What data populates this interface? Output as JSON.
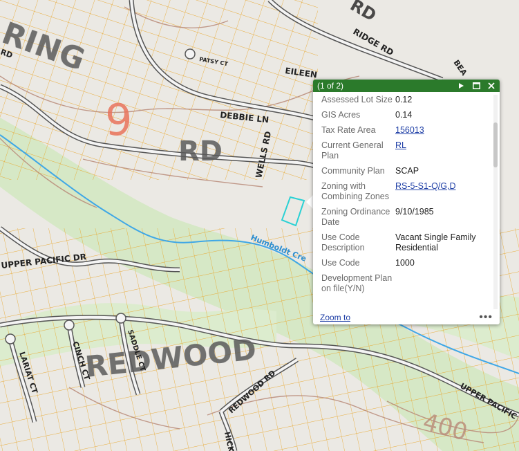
{
  "map": {
    "neighborhood_labels": [
      "RING",
      "RD",
      "REDWOOD"
    ],
    "district_number": "9",
    "elevation_label": "400",
    "streets": {
      "ridge": "RIDGE RD",
      "patsy": "PATSY CT",
      "eileen": "EILEEN",
      "debbie": "DEBBIE LN",
      "wells": "WELLS RD",
      "upper_pacific": "UPPER PACIFIC DR",
      "upper_pacific_2": "UPPER PACIFIC",
      "lariat": "LARIAT CT",
      "cinch": "CINCH CT",
      "saddle": "SADDLE CT",
      "redwood_rd": "REDWOOD RD",
      "hick": "HICK",
      "bea": "BEA",
      "rd_top": "RD",
      "rd_left": "RD"
    },
    "creek_label": "Humboldt Cre",
    "colors": {
      "parcel": "#e8a528",
      "creek": "#3fa7e6",
      "green": "#cfe5bf",
      "contour": "#b98a78",
      "district": "#e9745c",
      "highlight": "#2ad1d4"
    }
  },
  "popup": {
    "count": "(1 of 2)",
    "header_color": "#2b7a2b",
    "rows": [
      {
        "label": "Assessed Lot Size",
        "value": "0.12",
        "link": false
      },
      {
        "label": "GIS Acres",
        "value": "0.14",
        "link": false
      },
      {
        "label": "Tax Rate Area",
        "value": "156013",
        "link": true
      },
      {
        "label": "Current General Plan",
        "value": "RL",
        "link": true
      },
      {
        "label": "Community Plan",
        "value": "SCAP",
        "link": false
      },
      {
        "label": "Zoning with Combining Zones",
        "value": "RS-5-S1-Q/G,D",
        "link": true
      },
      {
        "label": "Zoning Ordinance Date",
        "value": "9/10/1985",
        "link": false
      },
      {
        "label": "Use Code Description",
        "value": "Vacant Single Family Residential",
        "link": false
      },
      {
        "label": "Use Code",
        "value": "1000",
        "link": false
      },
      {
        "label": "Development Plan on file(Y/N)",
        "value": "",
        "link": false
      }
    ],
    "zoom_to": "Zoom to",
    "more": "•••"
  }
}
